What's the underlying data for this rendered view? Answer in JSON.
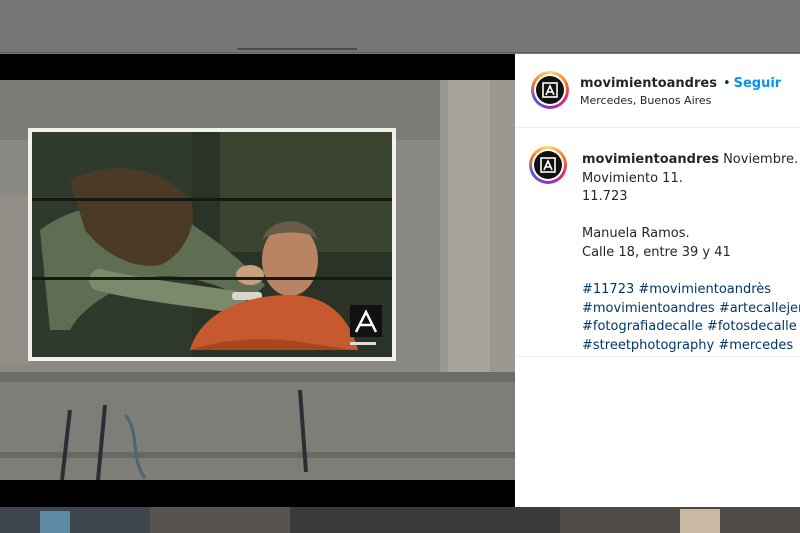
{
  "post": {
    "username": "movimientoandres",
    "follow_label": "Seguir",
    "separator": "•",
    "location": "Mercedes, Buenos Aires"
  },
  "caption": {
    "username": "movimientoandres",
    "lines": [
      "Noviembre.",
      "Movimiento 11.",
      "11.723",
      "",
      "Manuela Ramos.",
      "Calle 18, entre 39 y 41"
    ],
    "hashtags": [
      "#11723",
      "#movimientoandrès",
      "#movimientoandres",
      "#artecallejero",
      "#fotografiadecalle",
      "#fotosdecalle",
      "#streetphotography",
      "#mercedes"
    ]
  },
  "colors": {
    "follow": "#0095f6",
    "hashtag": "#00376b",
    "text": "#262626"
  },
  "icons": {
    "avatar": "movimiento-logo-icon"
  }
}
